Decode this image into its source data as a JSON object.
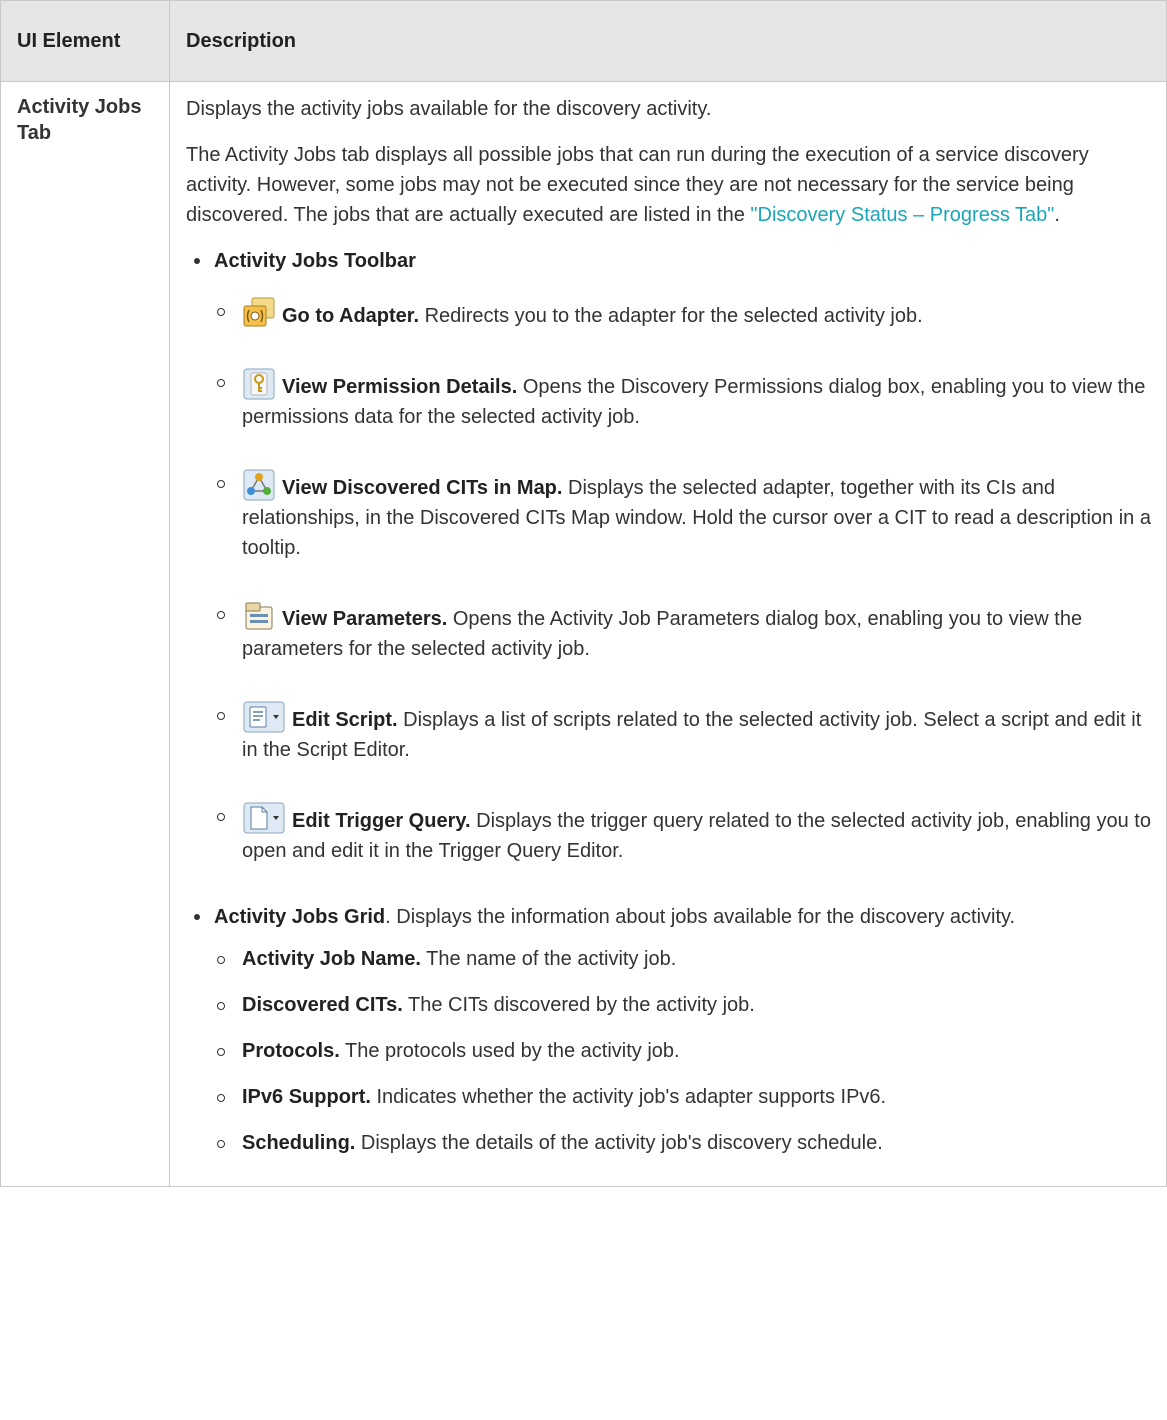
{
  "headers": {
    "ui_element": "UI Element",
    "description": "Description"
  },
  "row": {
    "element_name": "Activity Jobs Tab",
    "intro": "Displays the activity jobs available for the discovery activity.",
    "para_text": "The Activity Jobs tab displays all possible jobs that can run during the execution of a service discovery activity. However, some jobs may not be executed since they are not necessary for the service being discovered. The jobs that are actually executed are listed in the ",
    "para_link": "\"Discovery Status – Progress Tab\"",
    "para_end": ".",
    "toolbar_title": "Activity Jobs Toolbar",
    "toolbar_items": [
      {
        "icon": "go-to-adapter-icon",
        "name": "Go to Adapter.",
        "desc": " Redirects you to the adapter for the selected activity job."
      },
      {
        "icon": "key-permission-icon",
        "name": "View Permission Details.",
        "desc": " Opens the Discovery Permissions dialog box, enabling you to view the permissions data for the selected activity job."
      },
      {
        "icon": "cit-map-icon",
        "name": "View Discovered CITs in Map.",
        "desc": " Displays the selected adapter, together with its CIs and relationships, in the Discovered CITs Map window. Hold the cursor over a CIT to read a description in a tooltip."
      },
      {
        "icon": "parameters-icon",
        "name": "View Parameters.",
        "desc": " Opens the Activity Job Parameters dialog box, enabling you to view the parameters for the selected activity job."
      },
      {
        "icon": "edit-script-dropdown-icon",
        "name": "Edit Script.",
        "desc": " Displays a list of scripts related to the selected activity job. Select a script and edit it in the Script Editor."
      },
      {
        "icon": "edit-trigger-query-dropdown-icon",
        "name": "Edit Trigger Query.",
        "desc": " Displays the trigger query related to the selected activity job, enabling you to open and edit it in the Trigger Query Editor."
      }
    ],
    "grid_title": "Activity Jobs Grid",
    "grid_desc": ". Displays the information about jobs available for the discovery activity.",
    "grid_items": [
      {
        "name": "Activity Job Name.",
        "desc": " The name of the activity job."
      },
      {
        "name": "Discovered CITs.",
        "desc": " The CITs discovered by the activity job."
      },
      {
        "name": "Protocols.",
        "desc": " The protocols used by the activity job."
      },
      {
        "name": "IPv6 Support.",
        "desc": " Indicates whether the activity job's adapter supports IPv6."
      },
      {
        "name": "Scheduling.",
        "desc": " Displays the details of the activity job's discovery schedule."
      }
    ]
  }
}
